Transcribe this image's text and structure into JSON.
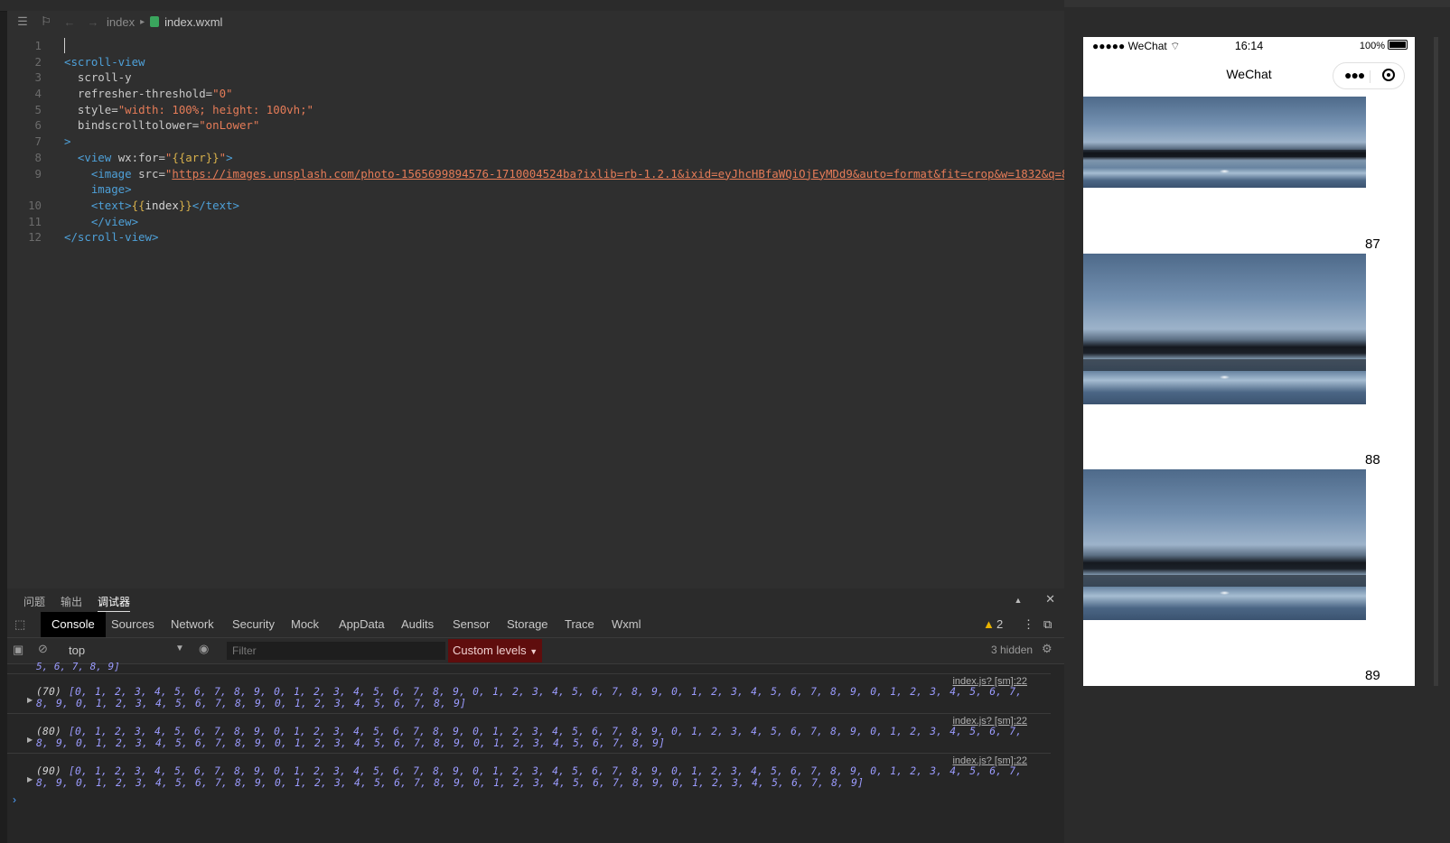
{
  "breadcrumb": {
    "folder": "index",
    "file": "index.wxml"
  },
  "code_lines": [
    {
      "n": "1",
      "segs": []
    },
    {
      "n": "2",
      "segs": [
        {
          "t": "<scroll-view",
          "c": "tag"
        }
      ]
    },
    {
      "n": "3",
      "segs": [
        {
          "t": "  scroll-y",
          "c": "attr"
        }
      ]
    },
    {
      "n": "4",
      "segs": [
        {
          "t": "  refresher-threshold=",
          "c": "attr"
        },
        {
          "t": "\"0\"",
          "c": "str"
        }
      ]
    },
    {
      "n": "5",
      "segs": [
        {
          "t": "  style=",
          "c": "attr"
        },
        {
          "t": "\"width: 100%; height: 100vh;\"",
          "c": "str"
        }
      ]
    },
    {
      "n": "6",
      "segs": [
        {
          "t": "  bindscrolltolower=",
          "c": "attr"
        },
        {
          "t": "\"onLower\"",
          "c": "str"
        }
      ]
    },
    {
      "n": "7",
      "segs": [
        {
          "t": ">",
          "c": "tag"
        }
      ]
    },
    {
      "n": "8",
      "segs": [
        {
          "t": "  <view ",
          "c": "tag"
        },
        {
          "t": "wx:for=",
          "c": "attr"
        },
        {
          "t": "\"",
          "c": "str"
        },
        {
          "t": "{{arr}}",
          "c": "brace"
        },
        {
          "t": "\"",
          "c": "str"
        },
        {
          "t": ">",
          "c": "tag"
        }
      ]
    },
    {
      "n": "9",
      "segs": [
        {
          "t": "    <image ",
          "c": "tag"
        },
        {
          "t": "src=",
          "c": "attr"
        },
        {
          "t": "\"",
          "c": "str"
        },
        {
          "t": "https://images.unsplash.com/photo-1565699894576-1710004524ba?ixlib=rb-1.2.1&ixid=eyJhcHBfaWQiOjEyMDd9&auto=format&fit=crop&w=1832&q=80",
          "c": "lnk"
        },
        {
          "t": "\"",
          "c": "str"
        },
        {
          "t": "></",
          "c": "tag"
        }
      ]
    },
    {
      "n": "",
      "segs": [
        {
          "t": "    image>",
          "c": "tag"
        }
      ]
    },
    {
      "n": "10",
      "segs": [
        {
          "t": "    <text>",
          "c": "tag"
        },
        {
          "t": "{{",
          "c": "brace"
        },
        {
          "t": "index",
          "c": "plain"
        },
        {
          "t": "}}",
          "c": "brace"
        },
        {
          "t": "</text>",
          "c": "tag"
        }
      ]
    },
    {
      "n": "11",
      "segs": [
        {
          "t": "    </view>",
          "c": "tag"
        }
      ]
    },
    {
      "n": "12",
      "segs": [
        {
          "t": "</scroll-view>",
          "c": "tag"
        }
      ]
    }
  ],
  "panel_tabs": [
    "问题",
    "输出",
    "调试器"
  ],
  "devtools_tabs": [
    "Console",
    "Sources",
    "Network",
    "Security",
    "Mock",
    "AppData",
    "Audits",
    "Sensor",
    "Storage",
    "Trace",
    "Wxml"
  ],
  "warnings": "2",
  "console": {
    "context": "top",
    "filter_placeholder": "Filter",
    "levels": "Custom levels",
    "hidden": "3 hidden",
    "prev_tail": "5, 6, 7, 8, 9]",
    "entries": [
      {
        "source": "index.js? [sm]:22",
        "count": "(70)",
        "text": "[0, 1, 2, 3, 4, 5, 6, 7, 8, 9, 0, 1, 2, 3, 4, 5, 6, 7, 8, 9, 0, 1, 2, 3, 4, 5, 6, 7, 8, 9, 0, 1, 2, 3, 4, 5, 6, 7, 8, 9, 0, 1, 2, 3, 4, 5, 6, 7, 8, 9, 0, 1, 2, 3, 4, 5, 6, 7, 8, 9, 0, 1, 2, 3, 4, 5, 6, 7, 8, 9]"
      },
      {
        "source": "index.js? [sm]:22",
        "count": "(80)",
        "text": "[0, 1, 2, 3, 4, 5, 6, 7, 8, 9, 0, 1, 2, 3, 4, 5, 6, 7, 8, 9, 0, 1, 2, 3, 4, 5, 6, 7, 8, 9, 0, 1, 2, 3, 4, 5, 6, 7, 8, 9, 0, 1, 2, 3, 4, 5, 6, 7, 8, 9, 0, 1, 2, 3, 4, 5, 6, 7, 8, 9, 0, 1, 2, 3, 4, 5, 6, 7, 8, 9, 0, 1, 2, 3, 4, 5, 6, 7, 8, 9]"
      },
      {
        "source": "index.js? [sm]:22",
        "count": "(90)",
        "text": "[0, 1, 2, 3, 4, 5, 6, 7, 8, 9, 0, 1, 2, 3, 4, 5, 6, 7, 8, 9, 0, 1, 2, 3, 4, 5, 6, 7, 8, 9, 0, 1, 2, 3, 4, 5, 6, 7, 8, 9, 0, 1, 2, 3, 4, 5, 6, 7, 8, 9, 0, 1, 2, 3, 4, 5, 6, 7, 8, 9, 0, 1, 2, 3, 4, 5, 6, 7, 8, 9, 0, 1, 2, 3, 4, 5, 6, 7, 8, 9, 0, 1, 2, 3, 4, 5, 6, 7, 8, 9]"
      }
    ]
  },
  "phone": {
    "carrier": "●●●●● WeChat",
    "time": "16:14",
    "battery": "100%",
    "nav_title": "WeChat",
    "items": [
      "87",
      "88",
      "89"
    ]
  },
  "icons": {
    "list": "list-icon",
    "bookmark": "bookmark-icon",
    "back": "arrow-left-icon",
    "forward": "arrow-right-icon",
    "inspect": "inspect-element-icon",
    "clear": "clear-console-icon",
    "eye": "eye-icon",
    "settings": "gear-icon"
  }
}
